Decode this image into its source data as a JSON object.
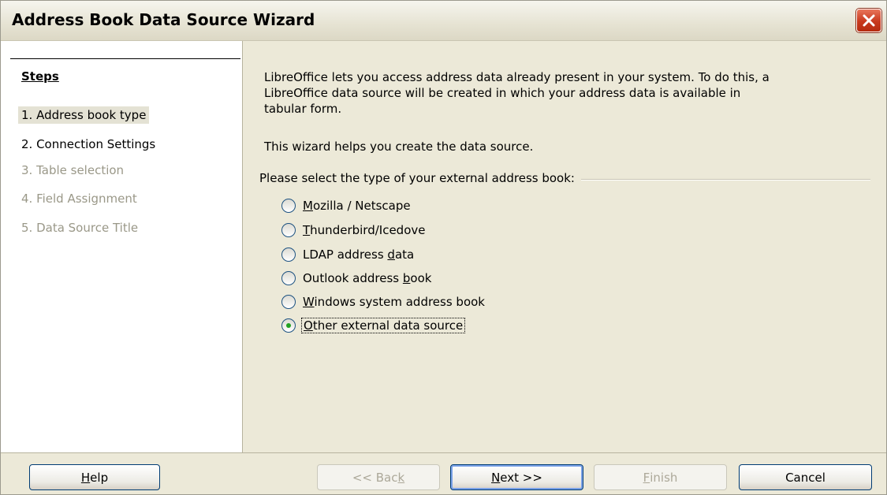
{
  "window": {
    "title": "Address Book Data Source Wizard"
  },
  "steps": {
    "heading": "Steps",
    "items": [
      {
        "label": "1. Address book type",
        "state": "active"
      },
      {
        "label": "2. Connection Settings",
        "state": "enabled"
      },
      {
        "label": "3. Table selection",
        "state": "disabled"
      },
      {
        "label": "4. Field Assignment",
        "state": "disabled"
      },
      {
        "label": "5. Data Source Title",
        "state": "disabled"
      }
    ]
  },
  "content": {
    "intro_line1": "LibreOffice lets you access address data already present in your system. To do this, a",
    "intro_line2": "LibreOffice data source will be created in which your address data is available in",
    "intro_line3": "tabular form.",
    "helper": "This wizard helps you create the data source.",
    "group_label": "Please select the type of your external address book:",
    "options": [
      {
        "pre": "",
        "key": "M",
        "post": "ozilla / Netscape",
        "selected": false
      },
      {
        "pre": "",
        "key": "T",
        "post": "hunderbird/Icedove",
        "selected": false
      },
      {
        "pre": "LDAP address ",
        "key": "d",
        "post": "ata",
        "selected": false
      },
      {
        "pre": "Outlook address ",
        "key": "b",
        "post": "ook",
        "selected": false
      },
      {
        "pre": "",
        "key": "W",
        "post": "indows system address book",
        "selected": false
      },
      {
        "pre": "",
        "key": "O",
        "post": "ther external data source",
        "selected": true
      }
    ]
  },
  "buttons": {
    "help": {
      "key": "H",
      "rest": "elp"
    },
    "back": {
      "pre": "<< Bac",
      "key": "k"
    },
    "next": {
      "key": "N",
      "rest": "ext >>"
    },
    "finish": {
      "key": "F",
      "rest": "inish"
    },
    "cancel": "Cancel"
  }
}
